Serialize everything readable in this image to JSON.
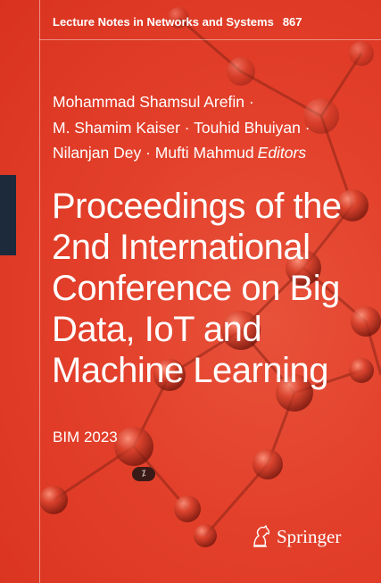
{
  "series": {
    "name": "Lecture Notes in Networks and Systems",
    "volume": "867"
  },
  "editors": {
    "line1": "Mohammad Shamsul Arefin ·",
    "line2": "M. Shamim Kaiser · Touhid Bhuiyan ·",
    "line3": "Nilanjan Dey · Mufti Mahmud",
    "role": "Editors"
  },
  "title": {
    "lines": [
      "Proceedings of the",
      "2nd International",
      "Conference on Big",
      "Data, IoT and",
      "Machine Learning"
    ]
  },
  "subtitle": "BIM 2023",
  "badge": {
    "icon": "magic-wand-icon",
    "glyph": "⁒"
  },
  "publisher": {
    "name": "Springer",
    "icon": "springer-horse-icon"
  },
  "colors": {
    "background": "#e3402b",
    "side_band": "#1d2a3c",
    "text": "#ffffff"
  }
}
